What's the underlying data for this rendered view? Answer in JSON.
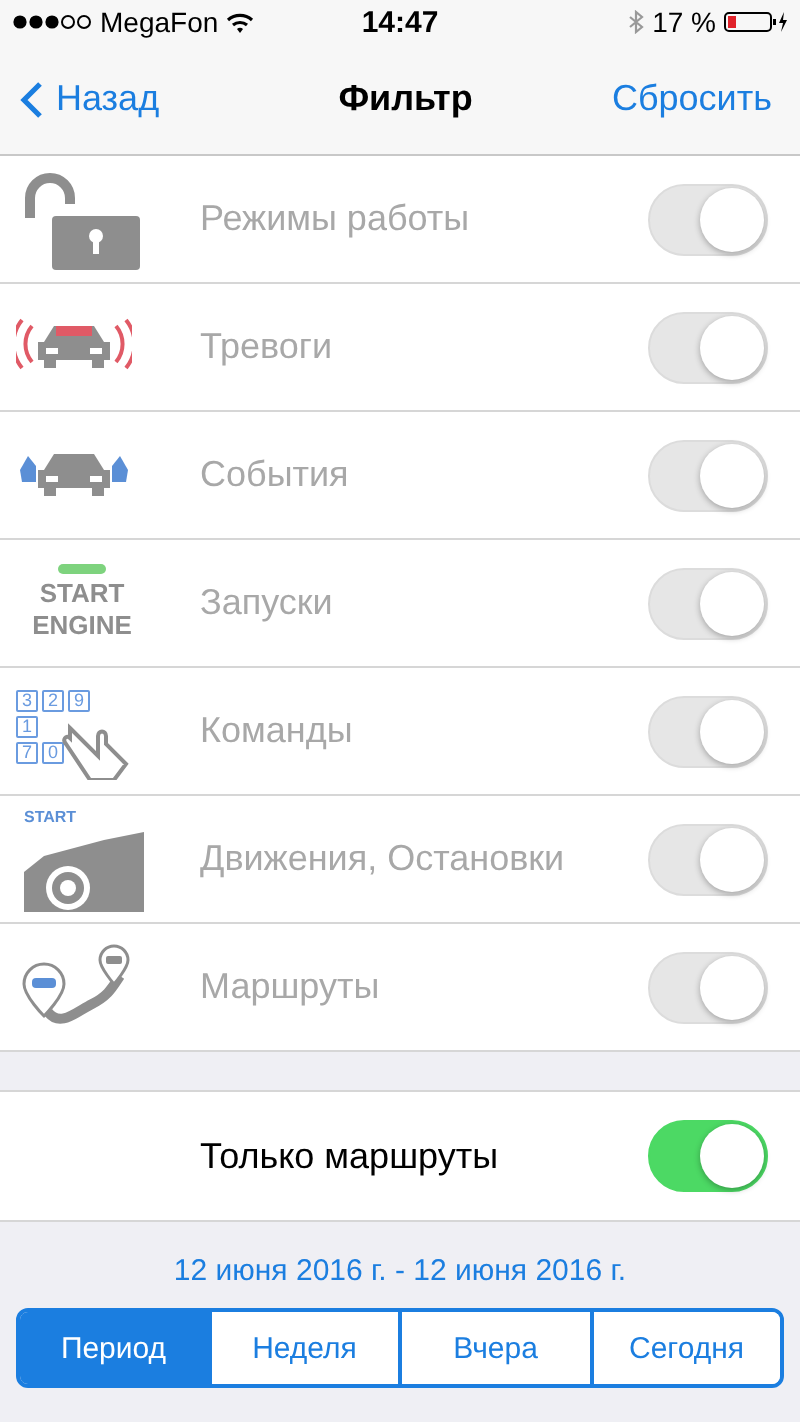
{
  "status_bar": {
    "carrier": "MegaFon",
    "time": "14:47",
    "battery": "17 %"
  },
  "nav": {
    "back": "Назад",
    "title": "Фильтр",
    "action": "Сбросить"
  },
  "filters": [
    {
      "kind": "lock",
      "label": "Режимы работы",
      "on": true,
      "disabled": true
    },
    {
      "kind": "alarm",
      "label": "Тревоги",
      "on": true,
      "disabled": true
    },
    {
      "kind": "doors",
      "label": "События",
      "on": true,
      "disabled": true
    },
    {
      "kind": "engine",
      "label": "Запуски",
      "on": true,
      "disabled": true,
      "icon_text": [
        "START",
        "ENGINE"
      ]
    },
    {
      "kind": "keypad",
      "label": "Команды",
      "on": true,
      "disabled": true,
      "icon_text": [
        "3",
        "2",
        "9",
        "1",
        "7",
        "0"
      ]
    },
    {
      "kind": "motion",
      "label": "Движения, Остановки",
      "on": true,
      "disabled": true,
      "icon_text": [
        "START"
      ]
    },
    {
      "kind": "routes",
      "label": "Маршруты",
      "on": true,
      "disabled": true
    }
  ],
  "only_routes": {
    "label": "Только маршруты",
    "on": true,
    "disabled": false
  },
  "date_range": "12 июня 2016 г. - 12 июня 2016 г.",
  "periods": [
    {
      "label": "Период",
      "selected": true
    },
    {
      "label": "Неделя",
      "selected": false
    },
    {
      "label": "Вчера",
      "selected": false
    },
    {
      "label": "Сегодня",
      "selected": false
    }
  ]
}
